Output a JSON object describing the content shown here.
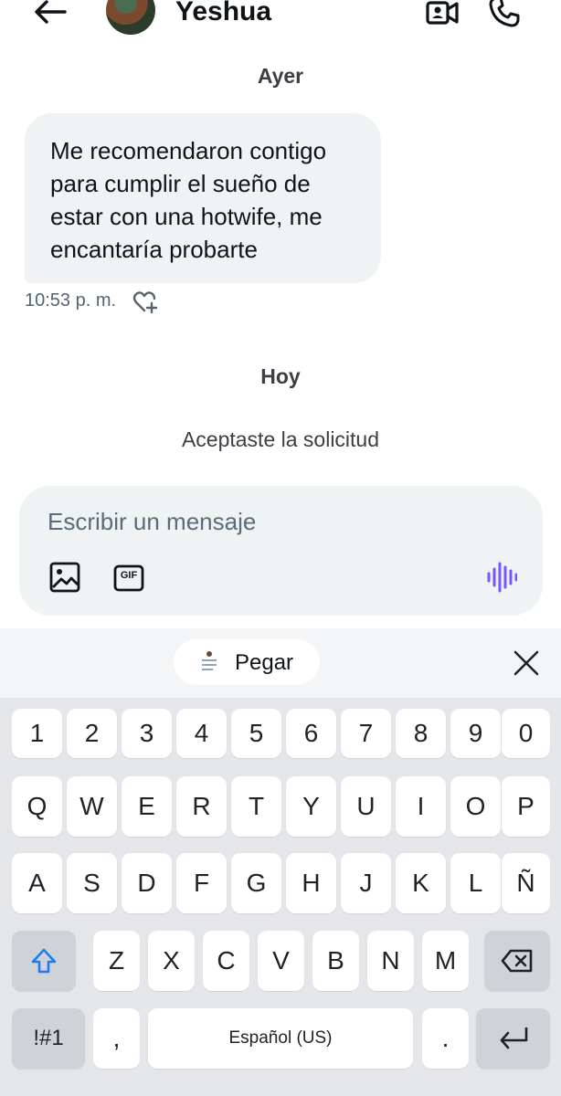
{
  "header": {
    "contact_name": "Yeshua"
  },
  "icons": {
    "back": "arrow-left-icon",
    "video": "video-camera-icon",
    "call": "phone-icon",
    "image": "image-icon",
    "gif": "gif-icon",
    "voice": "voice-waveform-icon",
    "react": "heart-plus-icon",
    "close": "close-icon",
    "shift": "shift-arrow-icon",
    "backspace": "backspace-icon",
    "enter": "enter-icon"
  },
  "conversation": {
    "date_yesterday": "Ayer",
    "message_text": "Me recomendaron contigo para cumplir el sueño de estar con una hotwife, me encantaría probarte",
    "message_time": "10:53 p. m.",
    "date_today": "Hoy",
    "system_note": "Aceptaste la solicitud"
  },
  "composer": {
    "placeholder": "Escribir un mensaje",
    "gif_label": "GIF"
  },
  "keyboard": {
    "paste_label": "Pegar",
    "row_numbers": [
      "1",
      "2",
      "3",
      "4",
      "5",
      "6",
      "7",
      "8",
      "9",
      "0"
    ],
    "row_qwerty": [
      "Q",
      "W",
      "E",
      "R",
      "T",
      "Y",
      "U",
      "I",
      "O",
      "P"
    ],
    "row_asdf": [
      "A",
      "S",
      "D",
      "F",
      "G",
      "H",
      "J",
      "K",
      "L",
      "Ñ"
    ],
    "row_zxcv": [
      "Z",
      "X",
      "C",
      "V",
      "B",
      "N",
      "M"
    ],
    "symbols_label": "!#1",
    "comma_label": ",",
    "space_label": "Español (US)",
    "period_label": "."
  },
  "colors": {
    "bubble_bg": "#eff3f4",
    "accent_voice": "#7856ff",
    "shift_blue": "#1d7cf2",
    "keyboard_bg": "#e4e6ea"
  }
}
